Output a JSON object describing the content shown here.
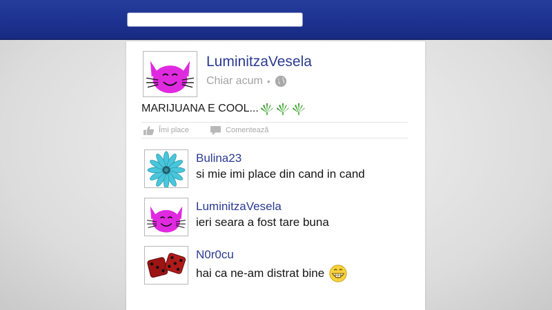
{
  "search": {
    "value": "",
    "placeholder": ""
  },
  "post": {
    "author": "LuminitzaVesela",
    "timestamp": "Chiar acum",
    "separator": "•",
    "text": "MARIJUANA E COOL...",
    "avatar_icon": "pink-cat-icon",
    "visibility_icon": "globe-icon",
    "decoration_icons": [
      "cannabis-leaf-icon",
      "cannabis-leaf-icon",
      "cannabis-leaf-icon"
    ],
    "actions": {
      "like_label": "Îmi place",
      "comment_label": "Comentează"
    }
  },
  "comments": [
    {
      "author": "Bulina23",
      "text": "si mie imi place din cand in cand",
      "avatar_icon": "blue-flower-icon"
    },
    {
      "author": "LuminitzaVesela",
      "text": "ieri seara a fost tare buna",
      "avatar_icon": "pink-cat-icon"
    },
    {
      "author": "N0r0cu",
      "text": "hai ca ne-am distrat bine",
      "avatar_icon": "red-dice-icon",
      "emoji_icon": "grinning-face-icon"
    }
  ],
  "colors": {
    "topbar": "#1d3290",
    "link": "#2a3a90",
    "muted": "#a3a3a3",
    "cat": "#e02ae0",
    "flower": "#49c6da",
    "dice": "#9c1414",
    "leaf": "#2f9a1e"
  }
}
